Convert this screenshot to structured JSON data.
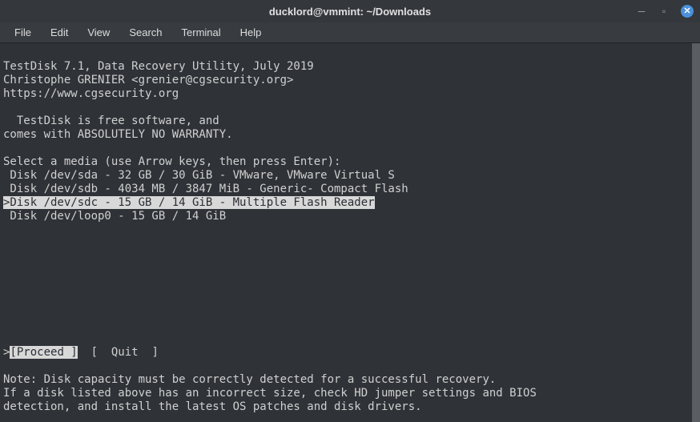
{
  "window": {
    "title": "ducklord@vmmint: ~/Downloads"
  },
  "menu": {
    "file": "File",
    "edit": "Edit",
    "view": "View",
    "search": "Search",
    "terminal": "Terminal",
    "help": "Help"
  },
  "term": {
    "header1": "TestDisk 7.1, Data Recovery Utility, July 2019",
    "header2": "Christophe GRENIER <grenier@cgsecurity.org>",
    "header3": "https://www.cgsecurity.org",
    "free1": "  TestDisk is free software, and",
    "free2": "comes with ABSOLUTELY NO WARRANTY.",
    "select": "Select a media (use Arrow keys, then press Enter):",
    "disk1": " Disk /dev/sda - 32 GB / 30 GiB - VMware, VMware Virtual S",
    "disk2": " Disk /dev/sdb - 4034 MB / 3847 MiB - Generic- Compact Flash",
    "disk3": ">Disk /dev/sdc - 15 GB / 14 GiB - Multiple Flash Reader",
    "disk4": " Disk /dev/loop0 - 15 GB / 14 GiB",
    "actions_prefix": ">",
    "proceed": "[Proceed ]",
    "actions_gap": "  ",
    "quit": "[  Quit  ]",
    "note1": "Note: Disk capacity must be correctly detected for a successful recovery.",
    "note2": "If a disk listed above has an incorrect size, check HD jumper settings and BIOS",
    "note3": "detection, and install the latest OS patches and disk drivers."
  }
}
